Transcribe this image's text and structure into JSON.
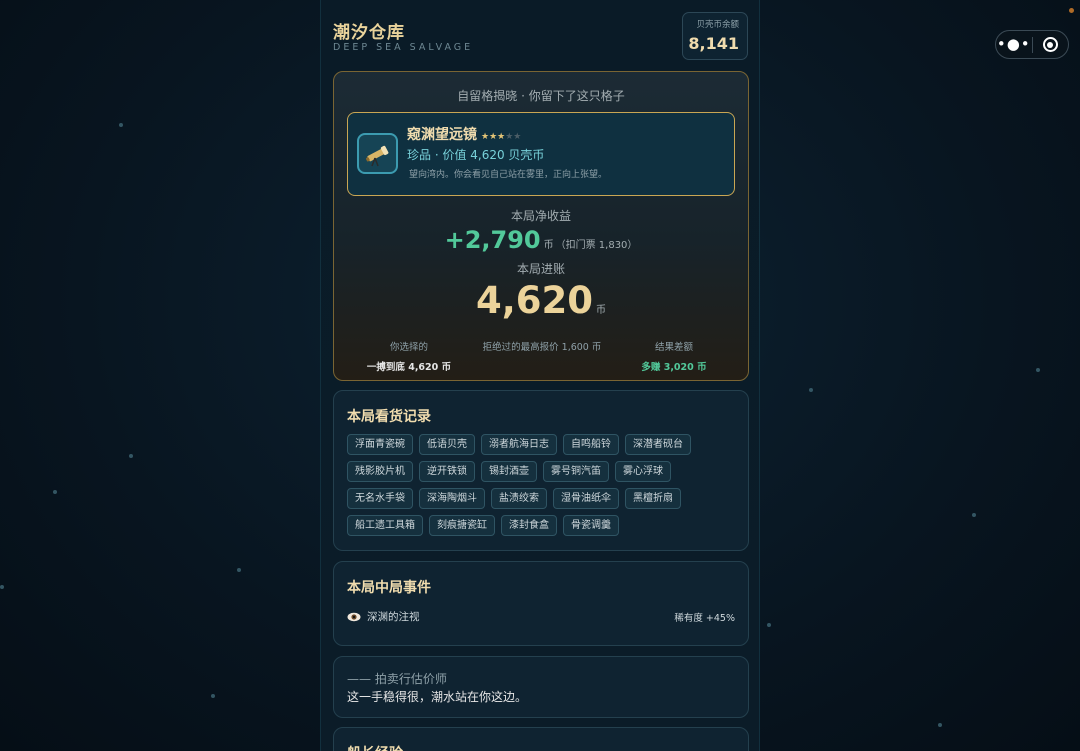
{
  "header": {
    "title": "潮汐仓库",
    "subtitle": "DEEP SEA SALVAGE",
    "balance_label": "贝壳币余额",
    "balance_value": "8,141"
  },
  "result": {
    "heading": "自留格揭晓 · 你留下了这只格子",
    "item": {
      "name": "窥渊望远镜",
      "stars_on": "★★★",
      "stars_off": "★★",
      "meta": "珍品 · 价值 4,620 贝壳币",
      "desc": "望向湾内。你会看见自己站在雾里，正向上张望。",
      "icon": "telescope-icon"
    },
    "net_label": "本局净收益",
    "net_value": "+2,790",
    "net_unit": "币",
    "net_note": "（扣门票 1,830）",
    "income_label": "本局进账",
    "income_value": "4,620",
    "income_unit": "币",
    "stats": [
      {
        "label": "你选择的",
        "value": "一搏到底 4,620 币"
      },
      {
        "label": "拒绝过的最高报价 1,600 币",
        "value": ""
      },
      {
        "label": "结果差额",
        "value": "多赚 3,020 币"
      }
    ]
  },
  "log": {
    "title": "本局看货记录",
    "tags": [
      "浮面青瓷碗",
      "低语贝壳",
      "溺者航海日志",
      "自鸣船铃",
      "深潜者砚台",
      "残影胶片机",
      "逆开铁锁",
      "锡封酒壶",
      "雾号铜汽笛",
      "雾心浮球",
      "无名水手袋",
      "深海陶烟斗",
      "盐渍绞索",
      "湿骨油纸伞",
      "黑檀折扇",
      "船工遗工具箱",
      "刻痕搪瓷缸",
      "漆封食盒",
      "骨瓷调羹"
    ]
  },
  "events": {
    "title": "本局中局事件",
    "items": [
      {
        "icon": "eye-icon",
        "name": "深渊的注视",
        "rarity": "稀有度 +45%"
      }
    ]
  },
  "quote": {
    "who": "—— 拍卖行估价师",
    "text": "这一手稳得很，潮水站在你这边。"
  },
  "exp": {
    "title": "船长经验"
  },
  "colors": {
    "accent_gold": "#e9d39b",
    "profit_green": "#52c99a",
    "item_cyan": "#78d1d9"
  }
}
